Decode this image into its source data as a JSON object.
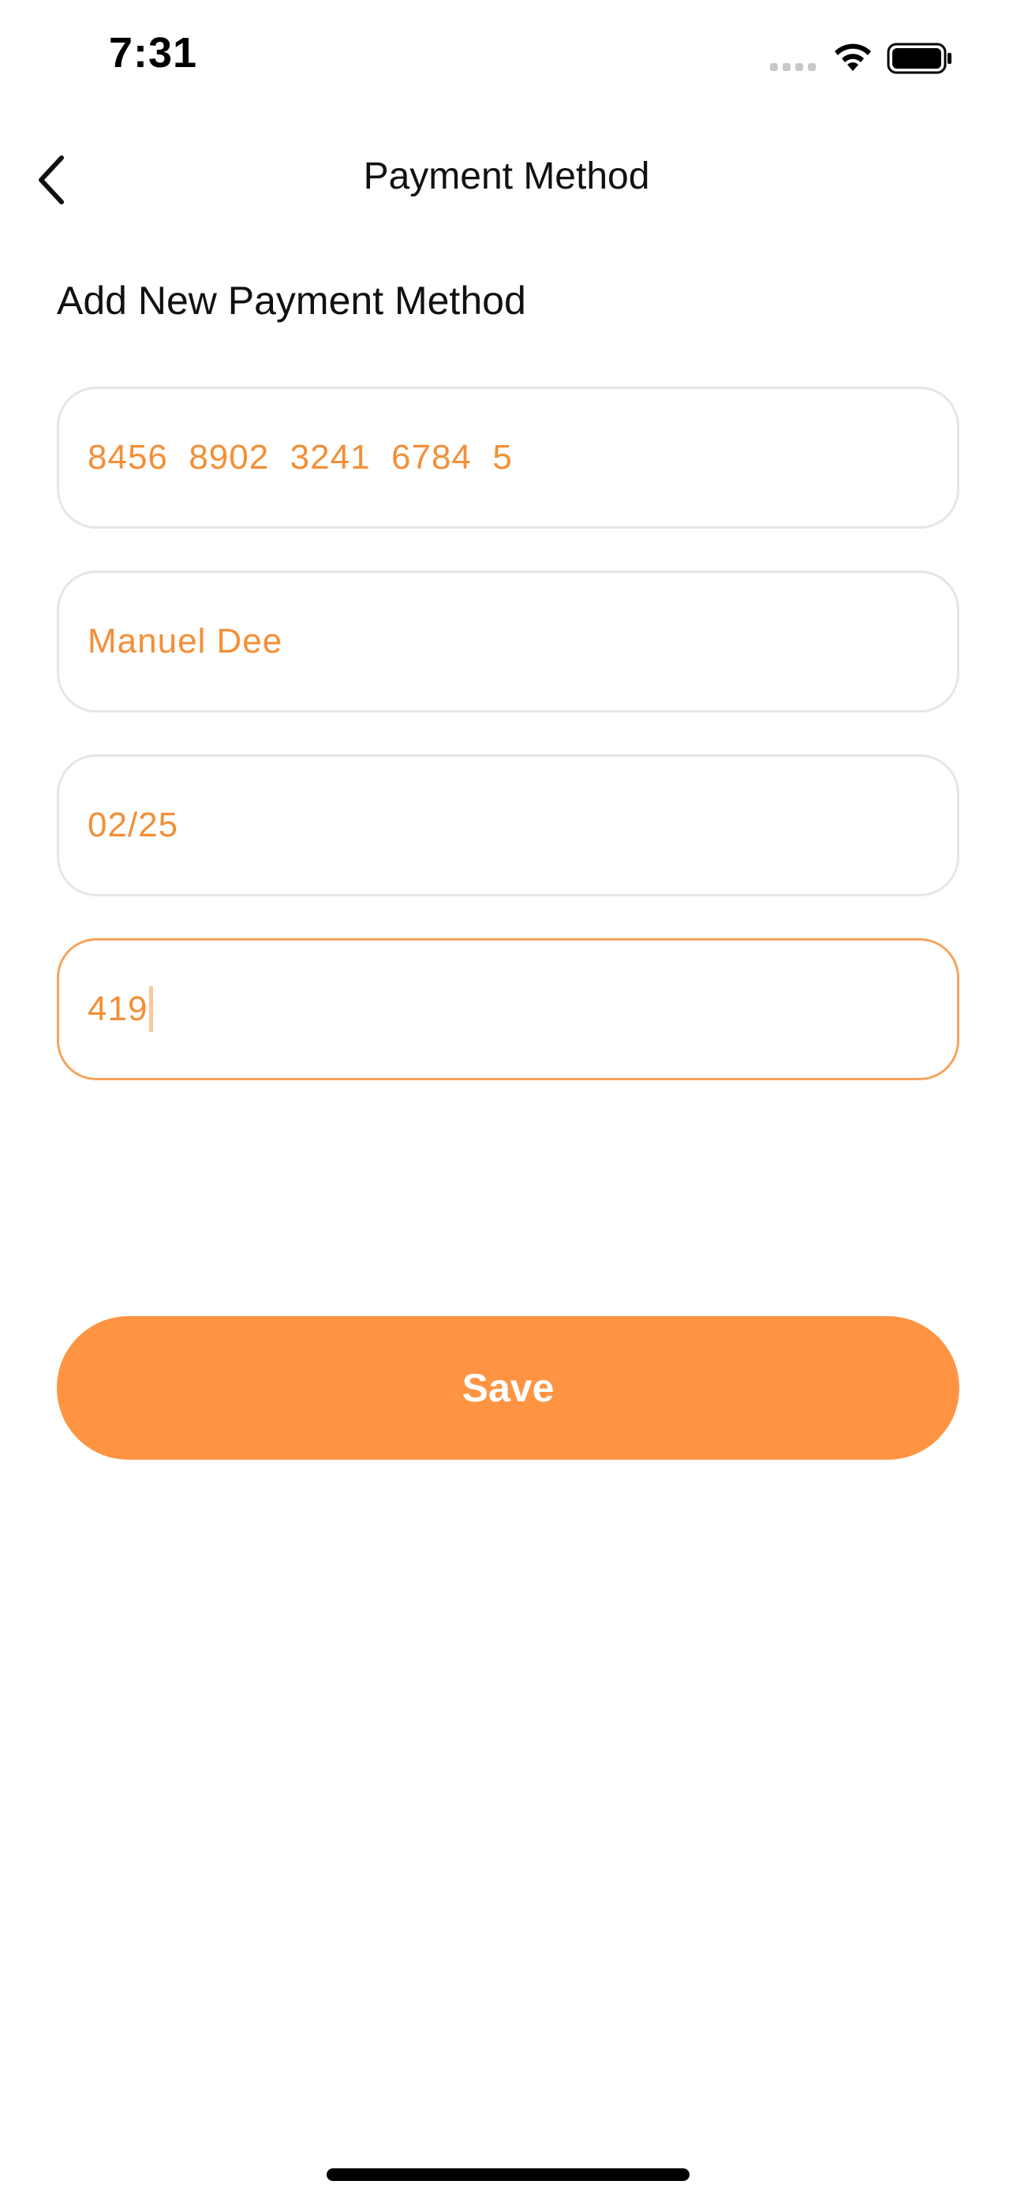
{
  "status_bar": {
    "time": "7:31"
  },
  "header": {
    "title": "Payment Method",
    "back_icon": "chevron-left-icon"
  },
  "form": {
    "section_title": "Add New Payment Method",
    "fields": [
      {
        "name": "card-number",
        "value": "8456  8902  3241  6784  5"
      },
      {
        "name": "cardholder-name",
        "value": "Manuel Dee"
      },
      {
        "name": "expiry-date",
        "value": "02/25"
      },
      {
        "name": "cvv",
        "value": "419"
      }
    ],
    "save_label": "Save"
  },
  "colors": {
    "accent": "#FE9442",
    "input_text": "#F38F37",
    "border": "#E6E6E6",
    "focused_border": "#F7A35C"
  }
}
